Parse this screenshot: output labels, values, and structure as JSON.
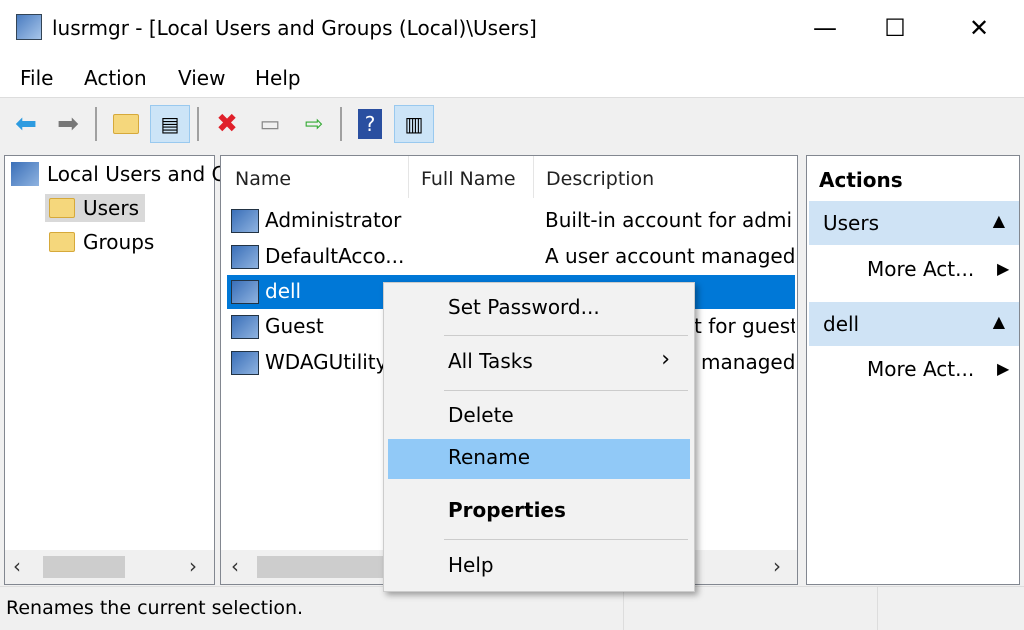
{
  "window": {
    "title": "lusrmgr - [Local Users and Groups (Local)\\Users]",
    "minimize": "—",
    "maximize": "☐",
    "close": "✕"
  },
  "menu": [
    "File",
    "Action",
    "View",
    "Help"
  ],
  "toolbar": [
    "back-icon",
    "forward-icon",
    "up-folder-icon",
    "show-hide-console-tree-icon",
    "delete-icon",
    "properties-icon",
    "export-list-icon",
    "help-icon",
    "show-hide-action-pane-icon"
  ],
  "tree": {
    "root": "Local Users and Groups (Local)",
    "items": [
      "Users",
      "Groups"
    ]
  },
  "list": {
    "columns": [
      "Name",
      "Full Name",
      "Description"
    ],
    "rows": [
      {
        "name": "Administrator",
        "full_name": "",
        "description": "Built-in account for admi"
      },
      {
        "name": "DefaultAcco...",
        "full_name": "",
        "description": "A user account managed"
      },
      {
        "name": "dell",
        "full_name": "",
        "description": ""
      },
      {
        "name": "Guest",
        "full_name": "",
        "description": "Built-in account for guest"
      },
      {
        "name": "WDAGUtilityAccount",
        "full_name": "",
        "description": "A user account managed"
      }
    ],
    "selected": "dell"
  },
  "actions": {
    "header": "Actions",
    "sections": [
      {
        "title": "Users",
        "item": "More Act..."
      },
      {
        "title": "dell",
        "item": "More Act..."
      }
    ]
  },
  "context_menu": {
    "items": [
      "Set Password...",
      "All Tasks",
      "Delete",
      "Rename",
      "Properties",
      "Help"
    ],
    "submenu_arrow": "›",
    "highlighted": "Rename"
  },
  "status": "Renames the current selection.",
  "colors": {
    "selection": "#0078d7",
    "menu_highlight": "#91c9f7",
    "action_section": "#cfe3f5"
  }
}
